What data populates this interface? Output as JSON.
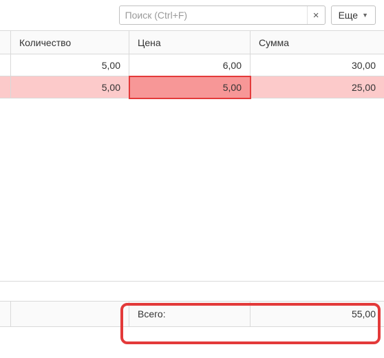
{
  "toolbar": {
    "search_placeholder": "Поиск (Ctrl+F)",
    "search_value": "",
    "clear_label": "×",
    "more_label": "Еще"
  },
  "grid": {
    "headers": {
      "quantity": "Количество",
      "price": "Цена",
      "sum": "Сумма"
    },
    "rows": [
      {
        "quantity": "5,00",
        "price": "6,00",
        "sum": "30,00",
        "error": false,
        "price_error": false
      },
      {
        "quantity": "5,00",
        "price": "5,00",
        "sum": "25,00",
        "error": true,
        "price_error": true
      }
    ]
  },
  "footer": {
    "total_label": "Всего:",
    "total_value": "55,00"
  }
}
